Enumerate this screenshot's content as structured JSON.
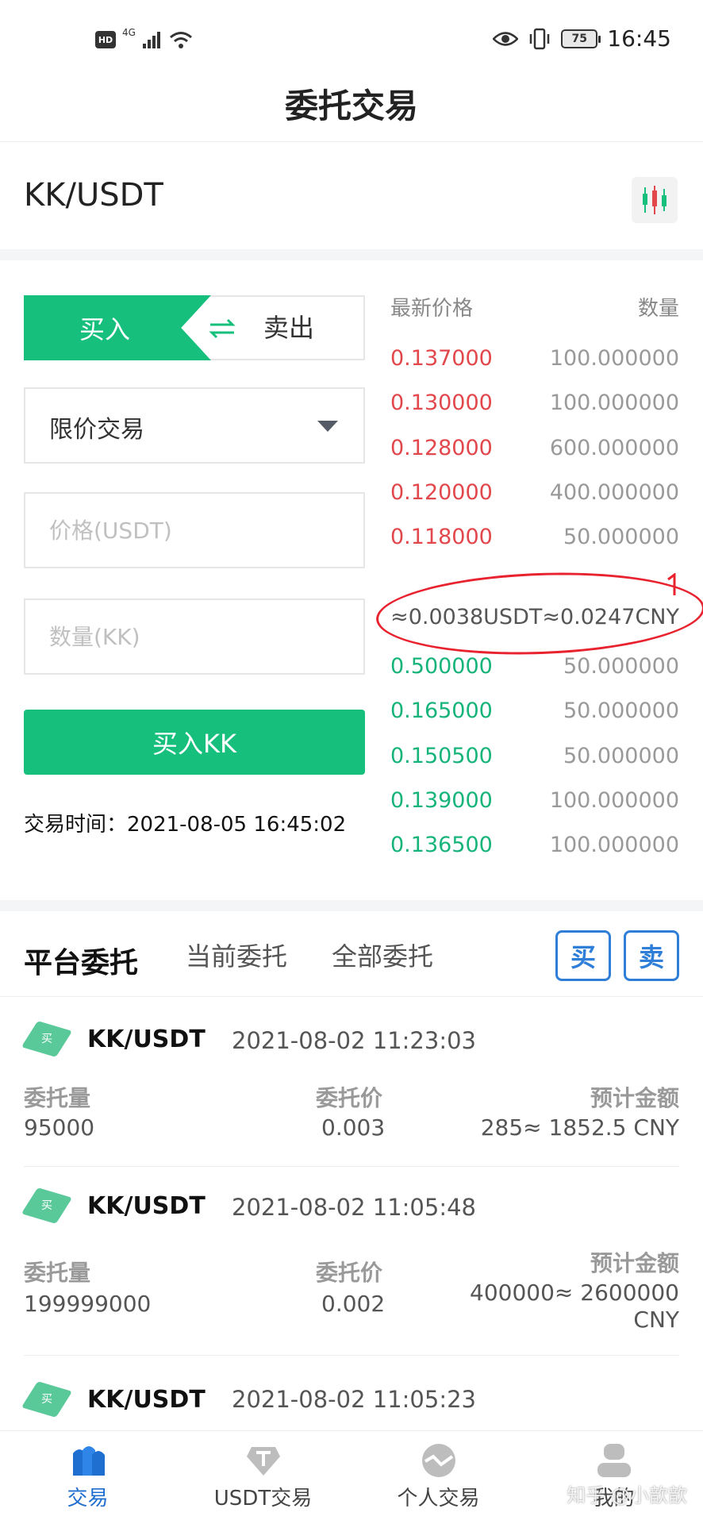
{
  "status_bar": {
    "hd": "HD",
    "network": "4G",
    "battery": "75",
    "time": "16:45"
  },
  "page": {
    "title": "委托交易"
  },
  "pair": {
    "name": "KK/USDT"
  },
  "form": {
    "buy_label": "买入",
    "sell_label": "卖出",
    "order_type": "限价交易",
    "price_placeholder": "价格(USDT)",
    "amount_placeholder": "数量(KK)",
    "submit_label": "买入KK",
    "trade_time": "交易时间：2021-08-05 16:45:02"
  },
  "orderbook": {
    "price_header": "最新价格",
    "qty_header": "数量",
    "asks": [
      {
        "price": "0.137000",
        "qty": "100.000000"
      },
      {
        "price": "0.130000",
        "qty": "100.000000"
      },
      {
        "price": "0.128000",
        "qty": "600.000000"
      },
      {
        "price": "0.120000",
        "qty": "400.000000"
      },
      {
        "price": "0.118000",
        "qty": "50.000000"
      }
    ],
    "mid_price": "≈0.0038USDT≈0.0247CNY",
    "bids": [
      {
        "price": "0.500000",
        "qty": "50.000000"
      },
      {
        "price": "0.165000",
        "qty": "50.000000"
      },
      {
        "price": "0.150500",
        "qty": "50.000000"
      },
      {
        "price": "0.139000",
        "qty": "100.000000"
      },
      {
        "price": "0.136500",
        "qty": "100.000000"
      }
    ]
  },
  "orders": {
    "title": "平台委托",
    "tab_current": "当前委托",
    "tab_all": "全部委托",
    "buy_button": "买",
    "sell_button": "卖",
    "col_amount": "委托量",
    "col_price": "委托价",
    "col_total": "预计金额",
    "badge": "买",
    "items": [
      {
        "pair": "KK/USDT",
        "time": "2021-08-02 11:23:03",
        "amount": "95000",
        "price": "0.003",
        "total": "285≈ 1852.5 CNY"
      },
      {
        "pair": "KK/USDT",
        "time": "2021-08-02 11:05:48",
        "amount": "199999000",
        "price": "0.002",
        "total_line1": "400000≈ 2600000",
        "total_line2": "CNY"
      },
      {
        "pair": "KK/USDT",
        "time": "2021-08-02 11:05:23"
      }
    ]
  },
  "nav": {
    "items": [
      {
        "label": "交易"
      },
      {
        "label": "USDT交易"
      },
      {
        "label": "个人交易"
      },
      {
        "label": "我的"
      }
    ],
    "watermark": "知乎 @小歆歆"
  },
  "colors": {
    "accent": "#16c07c",
    "ask": "#e2474c",
    "bid": "#16b47a",
    "link": "#2f7fd8",
    "annotation": "#e8222e"
  }
}
